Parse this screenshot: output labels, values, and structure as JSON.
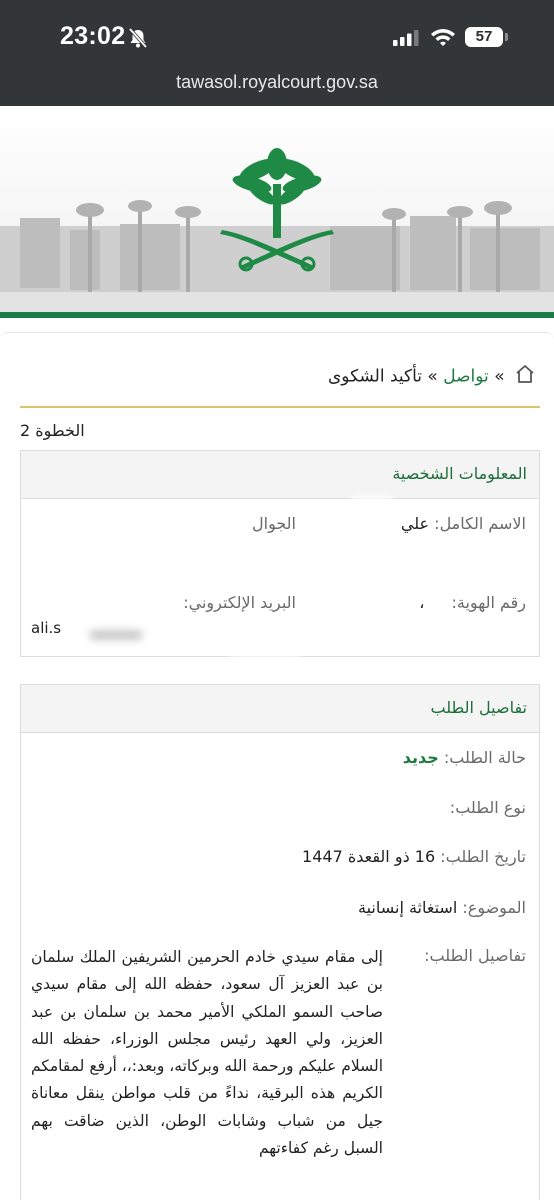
{
  "status_bar": {
    "time": "23:02",
    "battery": "57"
  },
  "browser": {
    "url": "tawasol.royalcourt.gov.sa"
  },
  "breadcrumb": {
    "sep1": "»",
    "link": "تواصل",
    "sep2": "»",
    "current": "تأكيد الشكوى"
  },
  "step": "الخطوة 2",
  "personal": {
    "title": "المعلومات الشخصية",
    "full_name_label": "الاسم الكامل:",
    "full_name_value": "علي",
    "mobile_label": "الجوال",
    "id_label": "رقم الهوية:",
    "id_value": "،",
    "email_label": "البريد الإلكتروني:",
    "email_value": "ali.s"
  },
  "request": {
    "title": "تفاصيل الطلب",
    "status_label": "حالة الطلب:",
    "status_value": "جديد",
    "type_label": "نوع الطلب:",
    "date_label": "تاريخ الطلب:",
    "date_value": "16 ذو القعدة 1447",
    "subject_label": "الموضوع:",
    "subject_value": "استغاثة إنسانية",
    "details_label": "تفاصيل الطلب:",
    "details_text": "إلى مقام سيدي خادم الحرمين الشريفين الملك سلمان بن عبد العزيز آل سعود، حفظه الله إلى مقام سيدي صاحب السمو الملكي الأمير محمد بن سلمان بن عبد العزيز، ولي العهد رئيس مجلس الوزراء، حفظه الله السلام عليكم ورحمة الله وبركاته، وبعد:،، أرفع لمقامكم الكريم هذه البرقية، نداءً من قلب مواطن ينقل معاناة جيل من شباب وشابات الوطن، الذين ضاقت بهم السبل رغم كفاءتهم"
  },
  "colors": {
    "accent_green": "#1d7a3f",
    "header_bar": "#333638",
    "divider_gold": "#d7c66a"
  },
  "icons": [
    "bell-slash-icon",
    "cellular-signal-icon",
    "wifi-icon",
    "battery-icon",
    "home-icon",
    "saudi-emblem-logo"
  ]
}
